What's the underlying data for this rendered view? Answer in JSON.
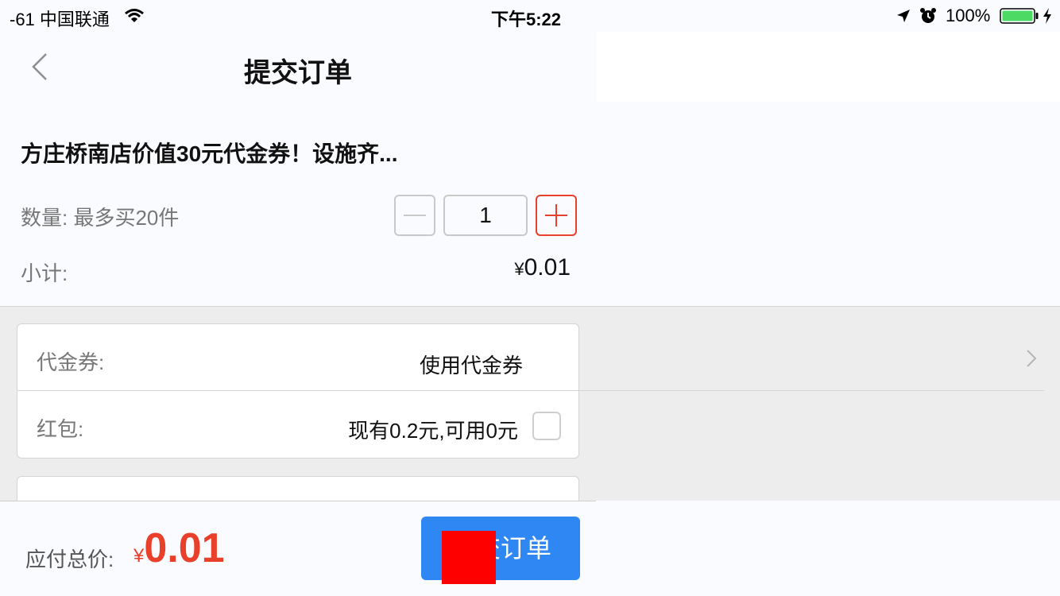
{
  "status_bar": {
    "carrier": "-61 中国联通",
    "time": "下午5:22",
    "battery_percent": "100%",
    "icons": [
      "wifi-icon",
      "location-icon",
      "alarm-icon",
      "battery-icon",
      "charging-icon"
    ]
  },
  "nav": {
    "back_icon": "chevron-left-icon",
    "title": "提交订单"
  },
  "product": {
    "title": "方庄桥南店价值30元代金券！设施齐...",
    "quantity_label": "数量: 最多买20件",
    "quantity_value": "1",
    "subtotal_label": "小计:",
    "subtotal_currency": "¥",
    "subtotal_amount": "0.01"
  },
  "options": {
    "voucher_label": "代金券:",
    "voucher_value": "使用代金券",
    "red_envelope_label": "红包:",
    "red_envelope_value": "现有0.2元,可用0元",
    "red_envelope_checked": false
  },
  "footer": {
    "total_label": "应付总价:",
    "total_currency": "¥",
    "total_amount": "0.01",
    "submit_label": "提交订单"
  },
  "colors": {
    "accent_red": "#e8402a",
    "primary_blue": "#2f87f3",
    "redaction": "#ff0000"
  }
}
